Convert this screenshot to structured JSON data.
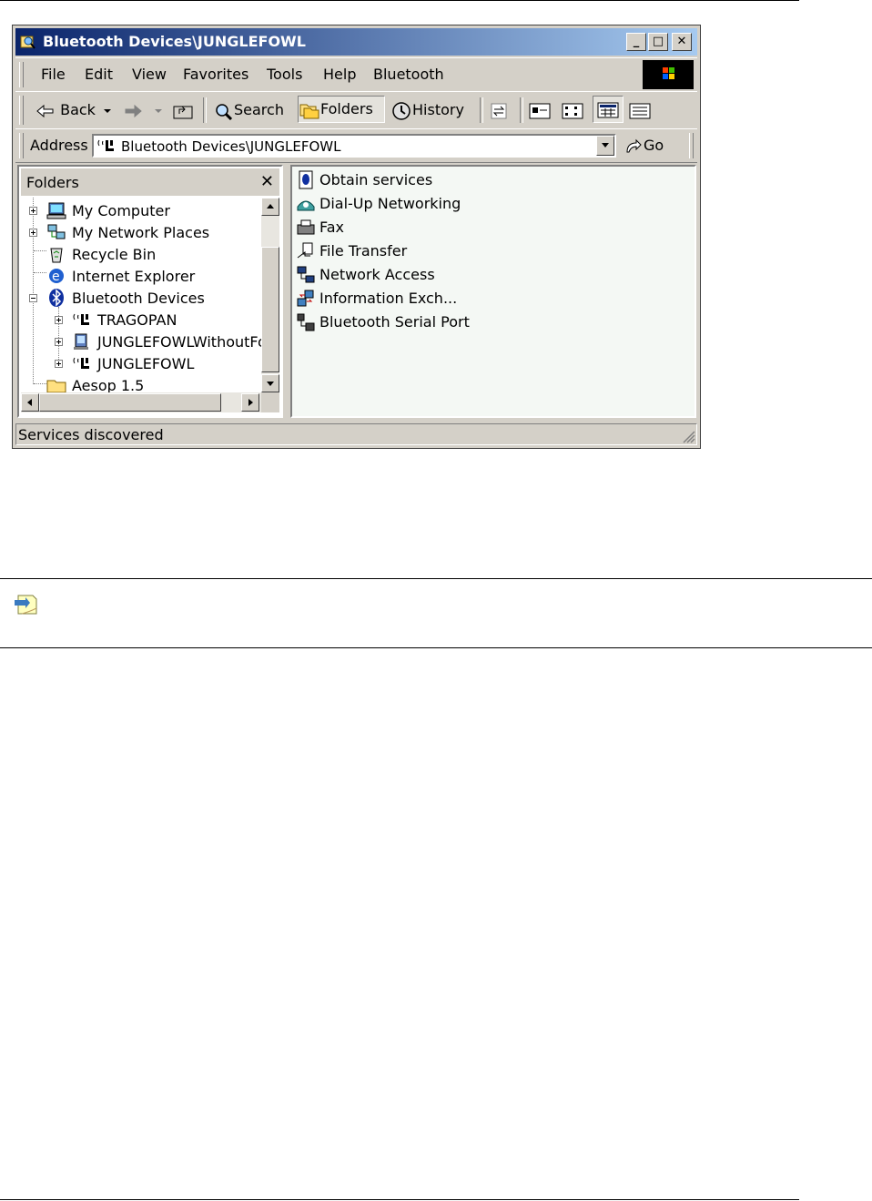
{
  "window": {
    "title": "Bluetooth Devices\\JUNGLEFOWL",
    "controls": {
      "minimize": "_",
      "maximize": "□",
      "close": "✕"
    }
  },
  "menu": {
    "items": [
      {
        "label": "File",
        "accel": "F"
      },
      {
        "label": "Edit",
        "accel": "E"
      },
      {
        "label": "View",
        "accel": "V"
      },
      {
        "label": "Favorites",
        "accel": "a"
      },
      {
        "label": "Tools",
        "accel": "T"
      },
      {
        "label": "Help",
        "accel": "H"
      },
      {
        "label": "Bluetooth",
        "accel": "B"
      }
    ]
  },
  "toolbar": {
    "back_label": "Back",
    "search_label": "Search",
    "folders_label": "Folders",
    "history_label": "History",
    "icons": [
      "back-arrow-icon",
      "forward-arrow-icon",
      "up-folder-icon",
      "search-icon",
      "folders-icon",
      "history-icon",
      "move-to-icon",
      "large-icons-view-icon",
      "small-icons-view-icon",
      "list-view-icon",
      "details-view-icon"
    ]
  },
  "address": {
    "label": "Address",
    "value": "Bluetooth Devices\\JUNGLEFOWL",
    "go_label": "Go"
  },
  "folders_pane": {
    "title": "Folders",
    "tree": [
      {
        "label": "My Computer",
        "icon": "my-computer-icon"
      },
      {
        "label": "My Network Places",
        "icon": "network-places-icon"
      },
      {
        "label": "Recycle Bin",
        "icon": "recycle-bin-icon"
      },
      {
        "label": "Internet Explorer",
        "icon": "internet-explorer-icon"
      },
      {
        "label": "Bluetooth Devices",
        "icon": "bluetooth-icon"
      },
      {
        "label": "TRAGOPAN",
        "icon": "bluetooth-device-icon"
      },
      {
        "label": "JUNGLEFOWLWithoutFo",
        "icon": "computer-device-icon"
      },
      {
        "label": "JUNGLEFOWL",
        "icon": "bluetooth-device-icon"
      },
      {
        "label": "Aesop 1.5",
        "icon": "folder-icon"
      }
    ]
  },
  "services": [
    {
      "label": "Obtain services",
      "icon": "obtain-services-icon"
    },
    {
      "label": "Dial-Up Networking",
      "icon": "dial-up-networking-icon"
    },
    {
      "label": "Fax",
      "icon": "fax-icon"
    },
    {
      "label": "File Transfer",
      "icon": "file-transfer-icon"
    },
    {
      "label": "Network Access",
      "icon": "network-access-icon"
    },
    {
      "label": "Information Exch...",
      "icon": "information-exchange-icon"
    },
    {
      "label": "Bluetooth Serial Port",
      "icon": "serial-port-icon"
    }
  ],
  "status_bar": {
    "text": "Services discovered"
  },
  "colors": {
    "title_start": "#0a246a",
    "title_end": "#a6caf0",
    "face": "#d4d0c8"
  }
}
